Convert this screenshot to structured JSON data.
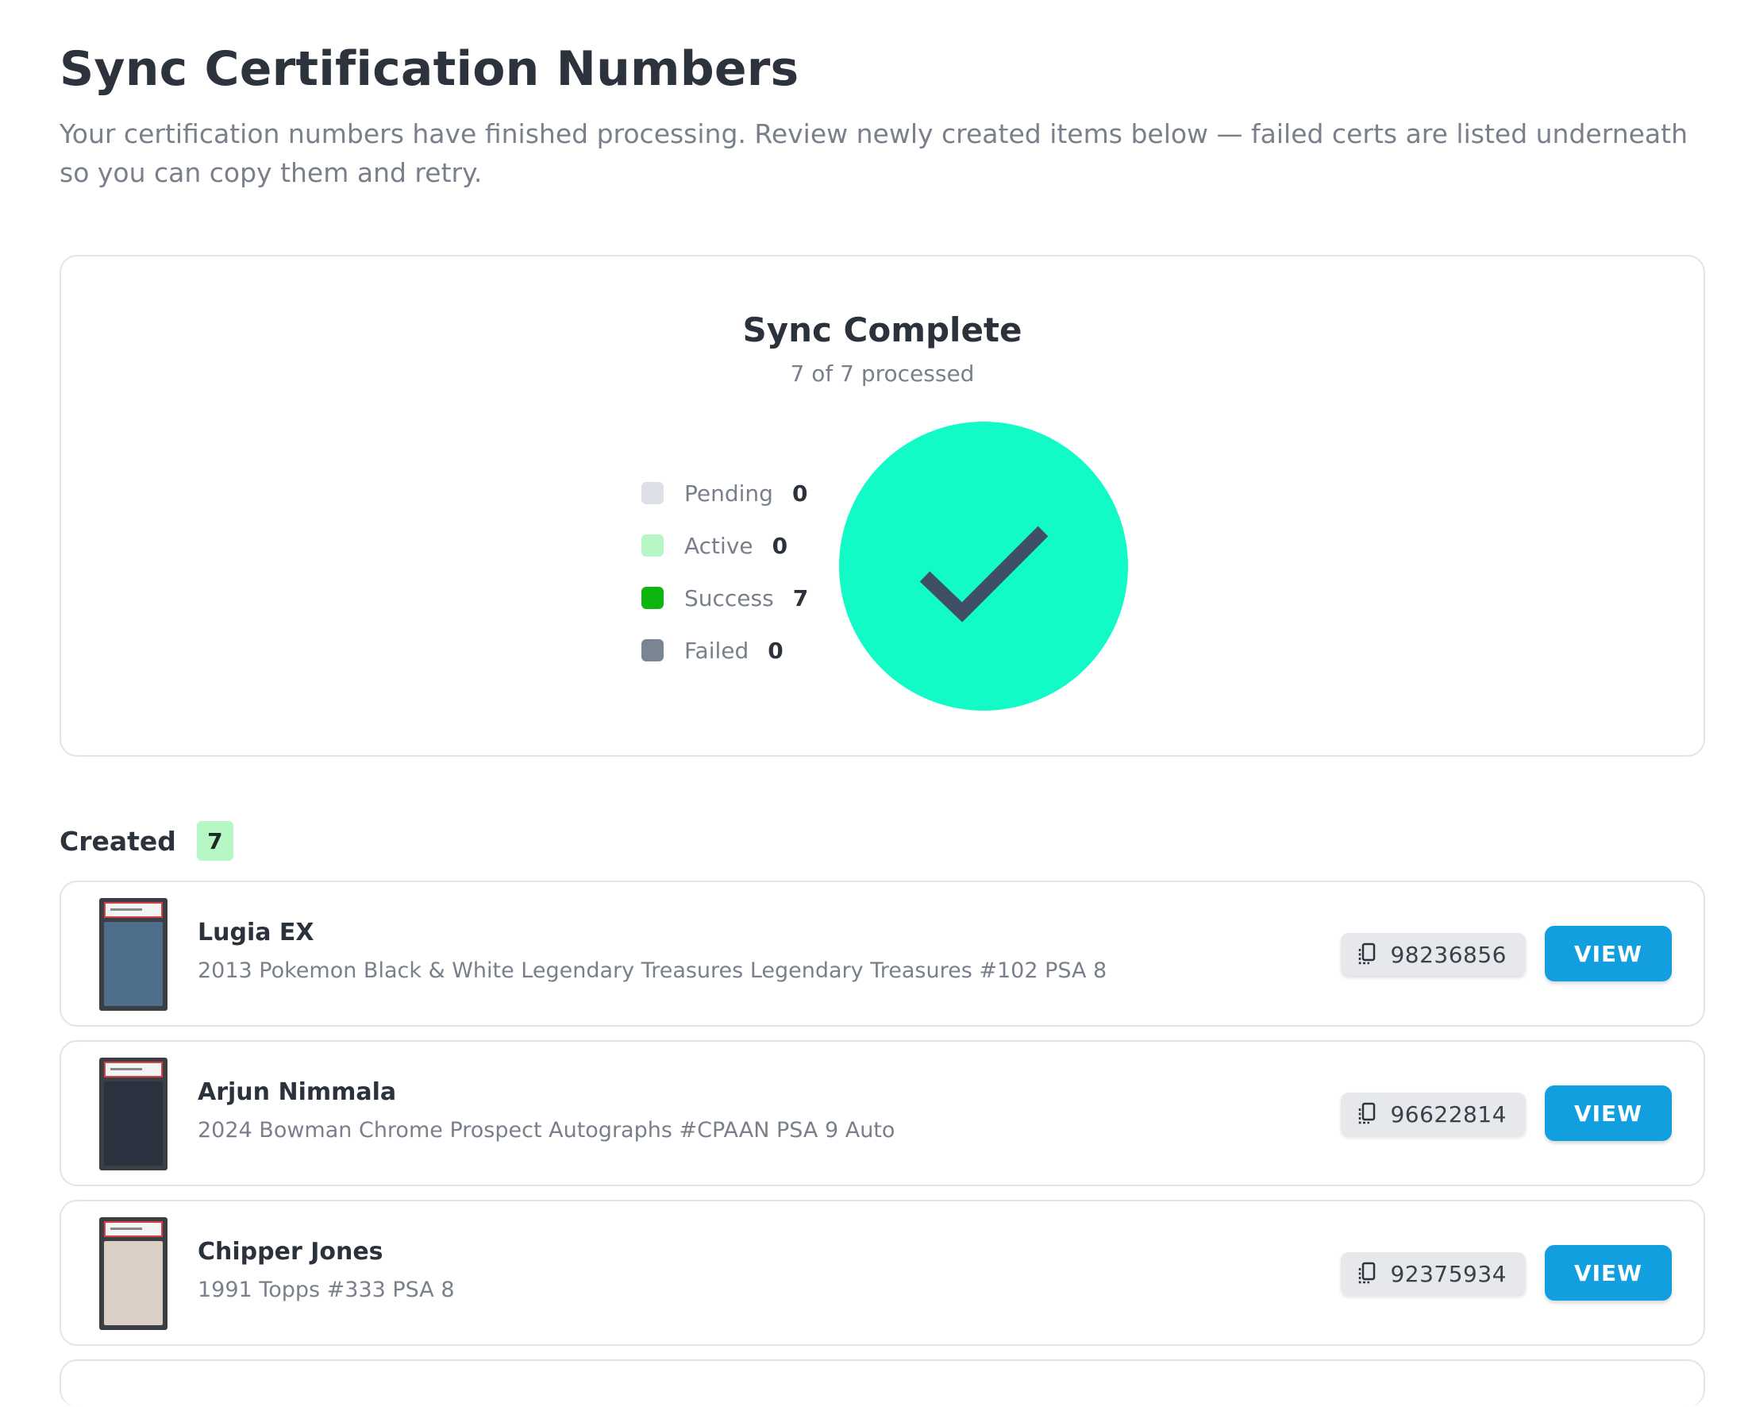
{
  "page": {
    "title": "Sync Certification Numbers",
    "subtitle": "Your certification numbers have finished processing. Review newly created items below — failed certs are listed underneath so you can copy them and retry."
  },
  "status": {
    "title": "Sync Complete",
    "progress_text": "7 of 7 processed",
    "processed": 7,
    "total": 7,
    "circle_color": "#12fbc6",
    "check_color": "#3f4f66",
    "legend": [
      {
        "label": "Pending",
        "count": "0",
        "color": "#dde0e6"
      },
      {
        "label": "Active",
        "count": "0",
        "color": "#b6f7c5"
      },
      {
        "label": "Success",
        "count": "7",
        "color": "#0fb50f"
      },
      {
        "label": "Failed",
        "count": "0",
        "color": "#7a8593"
      }
    ]
  },
  "created": {
    "label": "Created",
    "count": "7",
    "items": [
      {
        "name": "Lugia EX",
        "description": "2013 Pokemon Black & White Legendary Treasures Legendary Treasures #102 PSA 8",
        "cert": "98236856",
        "view_label": "VIEW",
        "thumb_color": "#4e6f8c"
      },
      {
        "name": "Arjun Nimmala",
        "description": "2024 Bowman Chrome Prospect Autographs #CPAAN PSA 9 Auto",
        "cert": "96622814",
        "view_label": "VIEW",
        "thumb_color": "#2c3340"
      },
      {
        "name": "Chipper Jones",
        "description": "1991 Topps #333 PSA 8",
        "cert": "92375934",
        "view_label": "VIEW",
        "thumb_color": "#d9cfc4"
      }
    ]
  },
  "colors": {
    "accent": "#119fe0",
    "border": "#e2e4e8",
    "muted_text": "#7a808b"
  }
}
